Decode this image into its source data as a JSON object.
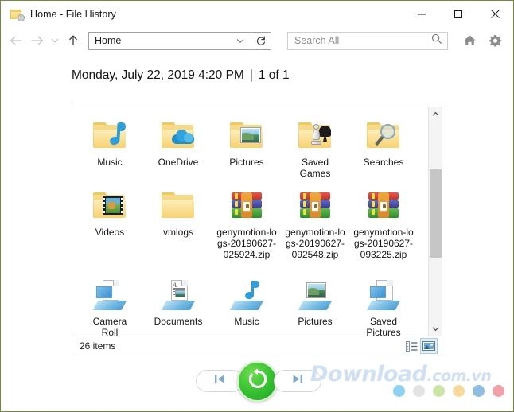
{
  "window": {
    "title": "Home - File History",
    "icon": "folder-history-icon",
    "controls": {
      "minimize": "minimize-icon",
      "maximize": "maximize-icon",
      "close": "close-icon"
    }
  },
  "toolbar": {
    "back": "back-arrow-icon",
    "forward": "forward-arrow-icon",
    "recent": "chevron-down-icon",
    "up": "up-arrow-icon",
    "address_value": "Home",
    "address_chevron": "chevron-down-icon",
    "refresh": "refresh-icon",
    "search_placeholder": "Search All",
    "search_icon": "search-icon",
    "home_icon": "home-icon",
    "settings_icon": "gear-icon"
  },
  "header": {
    "date": "Monday, July 22, 2019 4:20 PM",
    "separator": "|",
    "page_count": "1 of 1"
  },
  "content": {
    "rows": [
      [
        {
          "label": "Music",
          "icon": "folder-music-icon"
        },
        {
          "label": "OneDrive",
          "icon": "folder-onedrive-icon"
        },
        {
          "label": "Pictures",
          "icon": "folder-pictures-icon"
        },
        {
          "label": "Saved\nGames",
          "icon": "folder-saved-games-icon"
        },
        {
          "label": "Searches",
          "icon": "folder-searches-icon"
        }
      ],
      [
        {
          "label": "Videos",
          "icon": "folder-videos-icon"
        },
        {
          "label": "vmlogs",
          "icon": "folder-icon"
        },
        {
          "label": "genymotion-logs-20190627-025924.zip",
          "icon": "winrar-archive-icon"
        },
        {
          "label": "genymotion-logs-20190627-092548.zip",
          "icon": "winrar-archive-icon"
        },
        {
          "label": "genymotion-logs-20190627-093225.zip",
          "icon": "winrar-archive-icon"
        }
      ],
      [
        {
          "label": "Camera\nRoll",
          "icon": "library-camera-roll-icon"
        },
        {
          "label": "Documents",
          "icon": "library-documents-icon"
        },
        {
          "label": "Music",
          "icon": "library-music-icon"
        },
        {
          "label": "Pictures",
          "icon": "library-pictures-icon"
        },
        {
          "label": "Saved\nPictures",
          "icon": "library-saved-pictures-icon"
        }
      ]
    ],
    "scrollbar": {
      "up": "scroll-up-icon",
      "down": "scroll-down-icon"
    }
  },
  "statusbar": {
    "item_count": "26 items",
    "details_view": "details-view-icon",
    "large_icons_view": "large-icons-view-icon"
  },
  "bottom": {
    "previous": "previous-version-icon",
    "restore": "restore-icon",
    "next": "next-version-icon"
  },
  "watermark": {
    "brand": "Download",
    "suffix": ".com.vn",
    "dots": [
      "#8ed1f0",
      "#e3e3e3",
      "#cbe6a4",
      "#f8d99a",
      "#8fbde2",
      "#f2a1a8"
    ]
  },
  "colors": {
    "window_border": "#6f8a3c",
    "restore_green": "#33c02f",
    "accent_blue": "#2e9ed8",
    "folder_yellow": "#f0c657"
  }
}
